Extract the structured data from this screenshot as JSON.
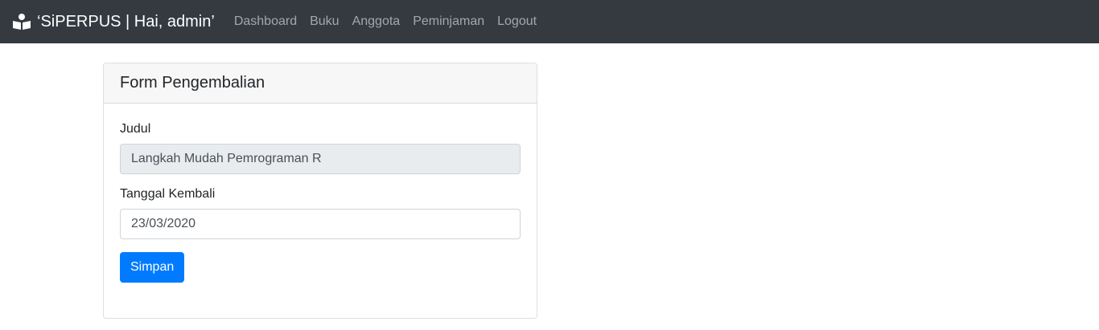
{
  "navbar": {
    "brand": "‘SiPERPUS | Hai, admin’",
    "brand_icon": "book-reader-icon",
    "links": [
      {
        "label": "Dashboard"
      },
      {
        "label": "Buku"
      },
      {
        "label": "Anggota"
      },
      {
        "label": "Peminjaman"
      },
      {
        "label": "Logout"
      }
    ]
  },
  "form": {
    "title": "Form Pengembalian",
    "judul_label": "Judul",
    "judul_value": "Langkah Mudah Pemrograman R",
    "tanggal_label": "Tanggal Kembali",
    "tanggal_value": "23/03/2020",
    "submit_label": "Simpan"
  },
  "colors": {
    "navbar_bg": "#343a40",
    "primary": "#007bff"
  }
}
